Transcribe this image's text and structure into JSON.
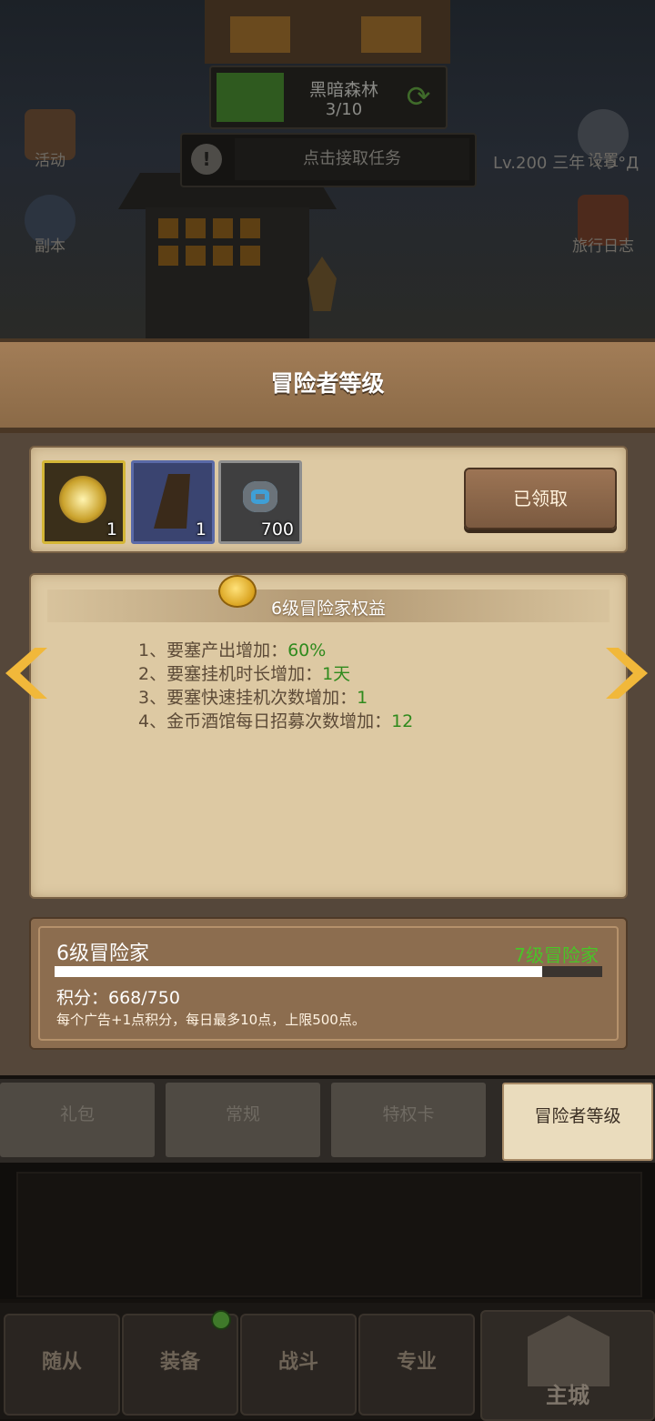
{
  "background": {
    "map": {
      "name": "黑暗森林",
      "progress": "3/10"
    },
    "task_button": "点击接取任务",
    "player_line": "Lv.200 三年（っ°Д",
    "left_icons": [
      {
        "label": "活动"
      },
      {
        "label": "副本"
      }
    ],
    "right_icons": [
      {
        "label": "设置"
      },
      {
        "label": "旅行日志"
      }
    ]
  },
  "modal": {
    "title": "冒险者等级",
    "rewards": [
      {
        "count": "1",
        "frame": "#d4b636",
        "icon": "crown-emblem-icon"
      },
      {
        "count": "1",
        "frame": "#5a6aa8",
        "icon": "cloak-icon"
      },
      {
        "count": "700",
        "frame": "#8e8e8e",
        "icon": "stone-icon"
      }
    ],
    "claim_button": "已领取",
    "benefit_title": "6级冒险家权益",
    "benefits": [
      {
        "text": "1、要塞产出增加：",
        "value": "60%",
        "value_green": true
      },
      {
        "text": "2、要塞挂机时长增加：",
        "value": "1天",
        "value_green": true
      },
      {
        "text": "3、要塞快速挂机次数增加：",
        "value": "1",
        "value_green": true
      },
      {
        "text": "4、金币酒馆每日招募次数增加：",
        "value": "12",
        "value_green": true
      }
    ],
    "level": {
      "current": "6级冒险家",
      "next": "7级冒险家",
      "points_text": "积分：668/750",
      "progress": 0.8907,
      "note": "每个广告+1点积分，每日最多10点，上限500点。"
    }
  },
  "tabs": [
    {
      "label": "礼包",
      "active": false
    },
    {
      "label": "常规",
      "active": false
    },
    {
      "label": "特权卡",
      "active": false
    },
    {
      "label": "冒险者等级",
      "active": true
    }
  ],
  "nav": [
    {
      "label": "随从"
    },
    {
      "label": "装备"
    },
    {
      "label": "战斗"
    },
    {
      "label": "专业"
    },
    {
      "label": "主城"
    }
  ],
  "colors": {
    "accent_green": "#49c428",
    "value_green": "#2f8a1d",
    "arrow": "#f1b83a"
  }
}
